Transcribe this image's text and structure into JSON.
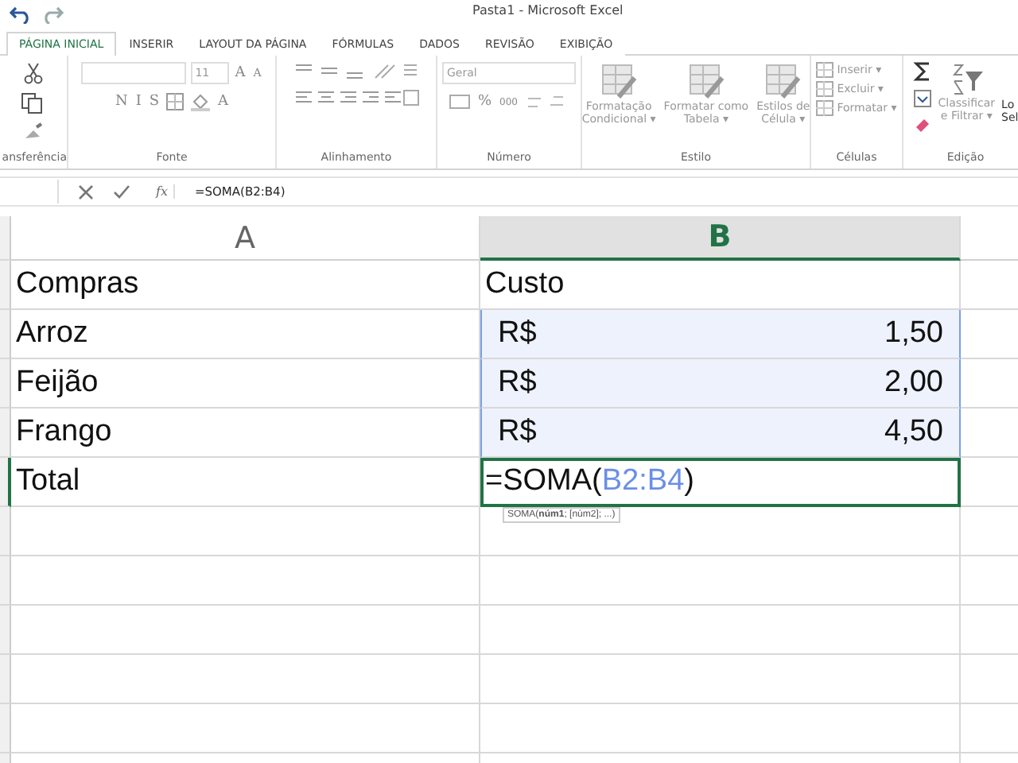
{
  "window": {
    "title": "Pasta1 - Microsoft Excel"
  },
  "tabs": [
    {
      "label": "PÁGINA INICIAL",
      "selected": true
    },
    {
      "label": "INSERIR",
      "selected": false
    },
    {
      "label": "LAYOUT DA PÁGINA",
      "selected": false
    },
    {
      "label": "FÓRMULAS",
      "selected": false
    },
    {
      "label": "DADOS",
      "selected": false
    },
    {
      "label": "REVISÃO",
      "selected": false
    },
    {
      "label": "EXIBIÇÃO",
      "selected": false
    }
  ],
  "ribbon": {
    "groups": [
      {
        "kind": "clipboard",
        "label": "ansferência"
      },
      {
        "kind": "font",
        "label": "Fonte",
        "font_size": "11",
        "grow": "A",
        "shrink": "A",
        "styles": [
          "N",
          "I",
          "S"
        ],
        "font_color": "A"
      },
      {
        "kind": "alignment",
        "label": "Alinhamento"
      },
      {
        "kind": "number",
        "label": "Número",
        "format": "Geral",
        "percent": "%",
        "thousands": "000"
      },
      {
        "kind": "styles",
        "label": "Estilo",
        "buttons": [
          {
            "lines": [
              "Formatação",
              "Condicional ▾"
            ]
          },
          {
            "lines": [
              "Formatar como",
              "Tabela ▾"
            ]
          },
          {
            "lines": [
              "Estilos de",
              "Célula ▾"
            ]
          }
        ]
      },
      {
        "kind": "cells",
        "label": "Células",
        "buttons": [
          "Inserir ▾",
          "Excluir ▾",
          "Formatar ▾"
        ]
      },
      {
        "kind": "editing",
        "label": "Edição",
        "sort_lines": [
          "Classificar",
          "e Filtrar ▾"
        ],
        "cut_lines": [
          "Lo",
          "Sel"
        ]
      }
    ]
  },
  "formula_bar": {
    "function_label": "fx",
    "formula": "=SOMA(B2:B4)"
  },
  "columns": [
    {
      "label": "A",
      "selected": false
    },
    {
      "label": "B",
      "selected": true
    }
  ],
  "rows": [
    {
      "a": "Compras",
      "b": {
        "kind": "text",
        "text": "Custo",
        "in_range": false,
        "active": false
      }
    },
    {
      "a": "Arroz",
      "b": {
        "kind": "currency",
        "symbol": "R$",
        "amount": "1,50",
        "in_range": true,
        "active": false
      }
    },
    {
      "a": "Feijão",
      "b": {
        "kind": "currency",
        "symbol": "R$",
        "amount": "2,00",
        "in_range": true,
        "active": false
      }
    },
    {
      "a": "Frango",
      "b": {
        "kind": "currency",
        "symbol": "R$",
        "amount": "4,50",
        "in_range": true,
        "active": false
      }
    },
    {
      "a": "Total",
      "b": {
        "kind": "formula",
        "parts": [
          {
            "kind": "text",
            "text": "=SOMA("
          },
          {
            "kind": "ref",
            "text": "B2"
          },
          {
            "kind": "ref",
            "text": ":B4"
          },
          {
            "kind": "text",
            "text": ")"
          }
        ],
        "in_range": false,
        "active": true
      }
    }
  ],
  "tooltip": "SOMA(**núm1**; [núm2]; ...)"
}
